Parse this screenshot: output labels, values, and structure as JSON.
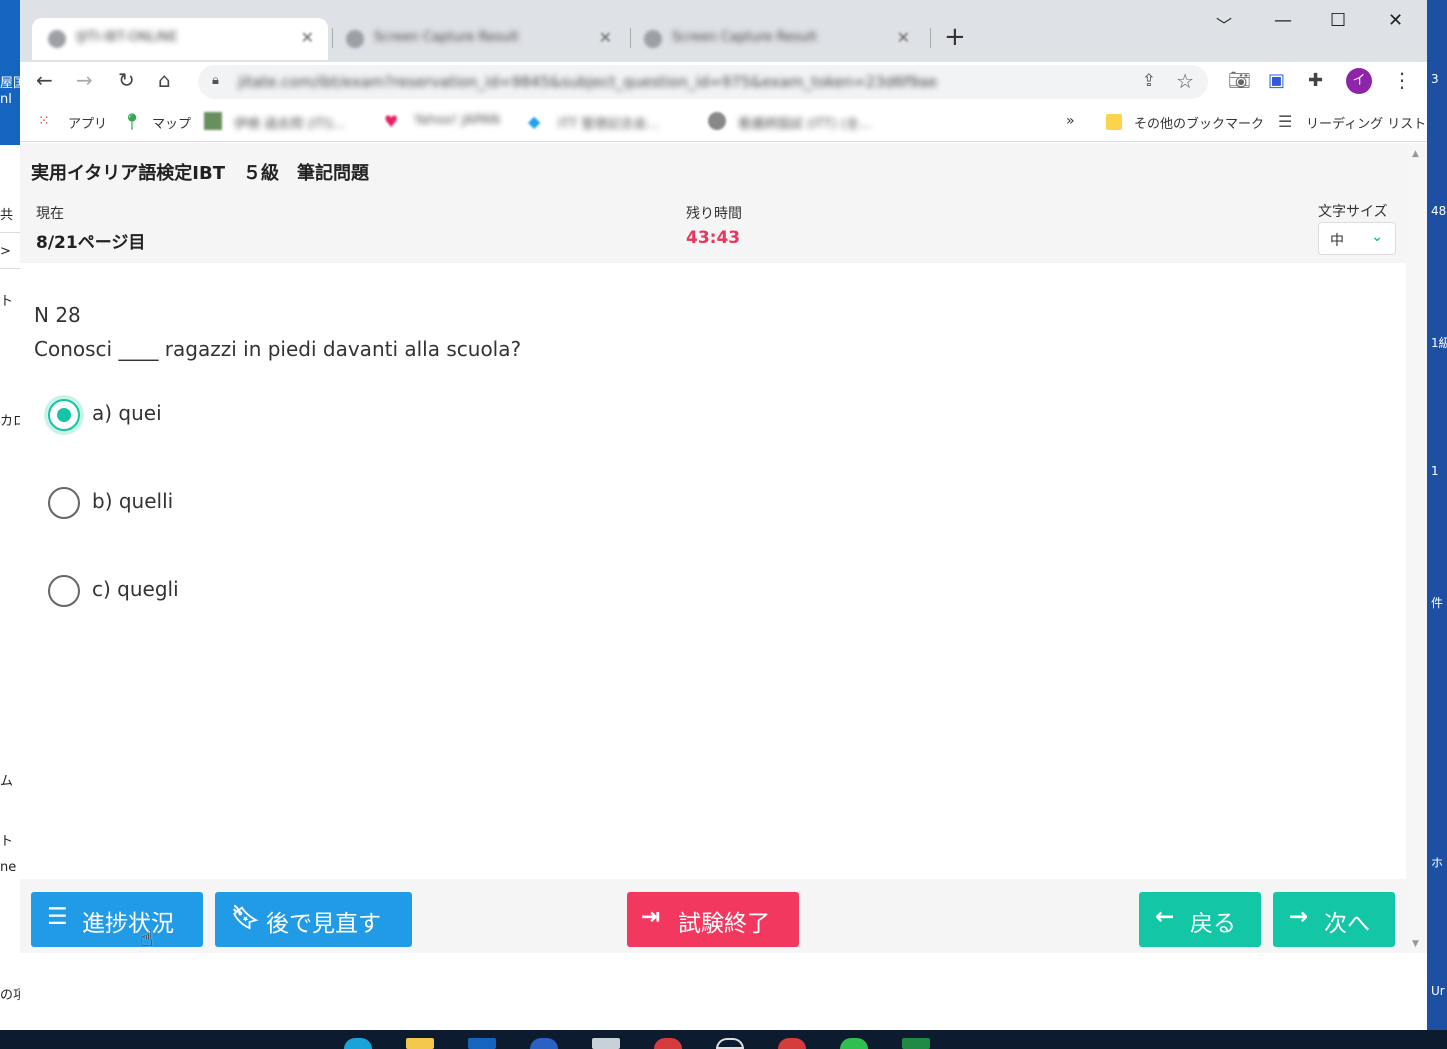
{
  "browser": {
    "tabs": [
      {
        "title": "IJITI-IBT-ONLINE"
      },
      {
        "title": "Screen Capture Result"
      },
      {
        "title": "Screen Capture Result"
      }
    ],
    "new_tab": "+",
    "url": "jitate.com/ibt/exam?reservation_id=9845&subject_question_id=975&exam_token=23d6f9ae"
  },
  "bookmarks": {
    "apps": "アプリ",
    "maps": "マップ",
    "blurred": [
      "伊検 過去問 (ITI)...",
      "Yahoo! JAPAN",
      "ITT 聖徳記念会...",
      "看護師国試 (ITT) (全..."
    ],
    "overflow": "»",
    "other": "その他のブックマーク",
    "reading_list": "リーディング リスト"
  },
  "exam": {
    "title": "実用イタリア語検定IBT　５級　筆記問題",
    "current_label": "現在",
    "current_value": "8/21ページ目",
    "time_label": "残り時間",
    "time_value": "43:43",
    "font_size_label": "文字サイズ",
    "font_size_value": "中"
  },
  "question": {
    "number": "N 28",
    "text": "Conosci ____ ragazzi in piedi davanti alla scuola?",
    "options": [
      {
        "label": "a) quei",
        "selected": true
      },
      {
        "label": "b) quelli",
        "selected": false
      },
      {
        "label": "c) quegli",
        "selected": false
      }
    ]
  },
  "footer": {
    "progress": "進捗状況",
    "review_later": "後で見直す",
    "end_exam": "試験終了",
    "back": "戻る",
    "next": "次へ"
  },
  "desktop": {
    "left_fragments": [
      "屋国",
      "nl",
      "共",
      ">",
      "ト",
      "カロ",
      "ム",
      "ト",
      "ne",
      "の項"
    ],
    "right_fragments": [
      "3",
      "48",
      "1級",
      "1",
      "件",
      "ホ",
      "Ur"
    ]
  },
  "colors": {
    "accent_teal": "#13c6a6",
    "button_blue": "#229be6",
    "button_red": "#f2385f",
    "timer_red": "#e8365d"
  }
}
